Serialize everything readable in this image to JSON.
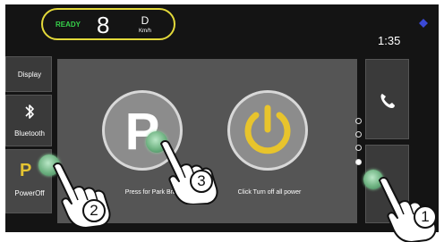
{
  "status": {
    "ready_label": "READY",
    "speed": "8",
    "gear": "D",
    "speed_unit": "Km/h",
    "time": "1:35"
  },
  "sidebar": {
    "items": [
      {
        "label": "Display",
        "icon": "display"
      },
      {
        "label": "Bluetooth",
        "icon": "bluetooth-icon"
      },
      {
        "label": "PowerOff",
        "icon": "park-icon",
        "icon_text": "P"
      }
    ]
  },
  "main": {
    "park_button": {
      "letter": "P",
      "caption": "Press for Park Brake"
    },
    "power_button": {
      "icon": "power-icon",
      "caption": "Click Turn off all power"
    }
  },
  "pagination": {
    "total": 4,
    "active": 4
  },
  "right_column": {
    "phone_icon": "phone-icon",
    "home_icon": "home-button"
  },
  "steps": [
    "1",
    "2",
    "3"
  ],
  "colors": {
    "accent_yellow": "#e3d93a",
    "ready_green": "#36d04a",
    "power_yellow": "#e8c42c",
    "panel_gray": "#555555",
    "background": "#141414"
  }
}
